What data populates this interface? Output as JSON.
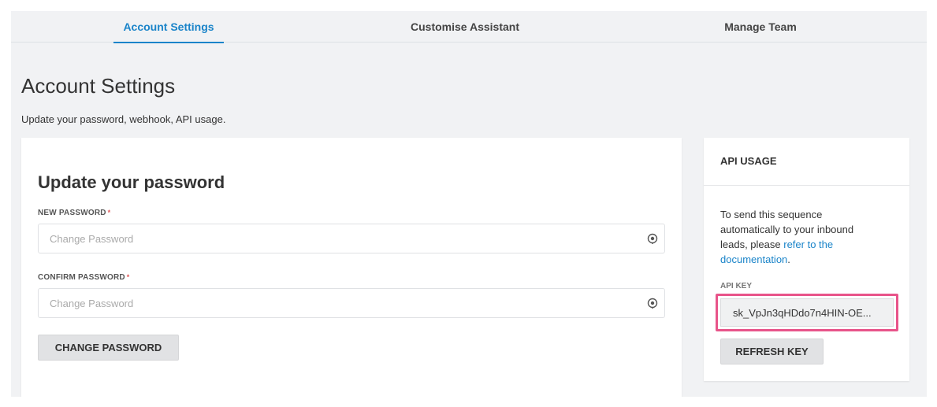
{
  "tabs": [
    {
      "label": "Account Settings",
      "active": true
    },
    {
      "label": "Customise Assistant",
      "active": false
    },
    {
      "label": "Manage Team",
      "active": false
    }
  ],
  "page": {
    "title": "Account Settings",
    "subtitle": "Update your password, webhook, API usage."
  },
  "password_card": {
    "title": "Update your password",
    "new_password": {
      "label": "NEW PASSWORD",
      "required_mark": "*",
      "placeholder": "Change Password",
      "value": ""
    },
    "confirm_password": {
      "label": "CONFIRM PASSWORD",
      "required_mark": "*",
      "placeholder": "Change Password",
      "value": ""
    },
    "change_button": "CHANGE PASSWORD"
  },
  "api_card": {
    "title": "API USAGE",
    "desc_prefix": "To send this sequence automatically to your inbound leads, please ",
    "desc_link": "refer to the documentation",
    "desc_suffix": ".",
    "key_label": "API KEY",
    "key_value": "sk_VpJn3qHDdo7n4HIN-OE...",
    "refresh_button": "REFRESH KEY"
  },
  "colors": {
    "accent": "#1a84c9",
    "highlight": "#e8548a",
    "required": "#e05a5a"
  },
  "icons": {
    "password_toggle": "eye-icon"
  }
}
